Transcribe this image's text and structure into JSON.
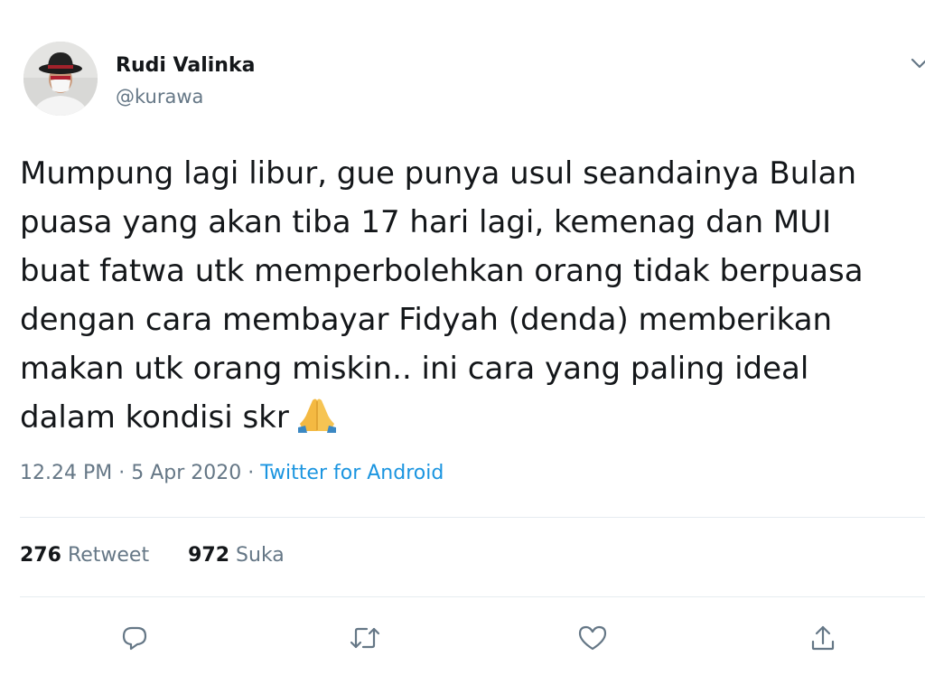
{
  "author": {
    "display_name": "Rudi Valinka",
    "handle": "@kurawa"
  },
  "tweet": {
    "lines": [
      "Mumpung lagi libur, gue punya usul seandainya Bulan",
      "puasa yang akan tiba 17 hari lagi, kemenag dan MUI",
      "buat fatwa utk memperbolehkan orang tidak berpuasa",
      "dengan cara membayar Fidyah  (denda) memberikan",
      "makan utk orang miskin.. ini cara yang paling ideal",
      "dalam kondisi skr"
    ],
    "emoji": "folded-hands-emoji"
  },
  "meta": {
    "time": "12.24 PM",
    "separator": "·",
    "date": "5 Apr 2020",
    "source": "Twitter for Android"
  },
  "stats": {
    "retweets_count": "276",
    "retweets_label": "Retweet",
    "likes_count": "972",
    "likes_label": "Suka"
  },
  "actions": [
    "reply-icon",
    "retweet-icon",
    "like-icon",
    "share-icon"
  ],
  "colors": {
    "text": "#14171a",
    "secondary": "#657786",
    "link": "#1b95e0",
    "divider": "#e6ecf0"
  }
}
